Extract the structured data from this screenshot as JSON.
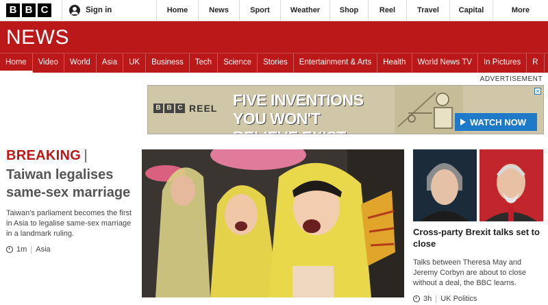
{
  "topbar": {
    "logo_letters": [
      "B",
      "B",
      "C"
    ],
    "signin_label": "Sign in",
    "nav": [
      "Home",
      "News",
      "Sport",
      "Weather",
      "Shop",
      "Reel",
      "Travel",
      "Capital",
      "More"
    ]
  },
  "news": {
    "title": "NEWS",
    "nav": [
      "Home",
      "Video",
      "World",
      "Asia",
      "UK",
      "Business",
      "Tech",
      "Science",
      "Stories",
      "Entertainment & Arts",
      "Health",
      "World News TV",
      "In Pictures",
      "R"
    ],
    "active_tab": "Home"
  },
  "ad": {
    "label": "ADVERTISEMENT",
    "brand_letters": [
      "B",
      "B",
      "C"
    ],
    "brand_suffix": "REEL",
    "headline": "FIVE INVENTIONS YOU WON'T BELIEVE EXIST",
    "cta": "WATCH NOW",
    "close_glyph": "✕"
  },
  "main_story": {
    "breaking_label": "BREAKING",
    "breaking_separator": "|",
    "headline": "Taiwan legalises same-sex marriage",
    "summary": "Taiwan's parliament becomes the first in Asia to legalise same-sex marriage in a landmark ruling.",
    "time": "1m",
    "section": "Asia"
  },
  "side_story": {
    "headline": "Cross-party Brexit talks set to close",
    "summary": "Talks between Theresa May and Jeremy Corbyn are about to close without a deal, the BBC learns.",
    "time": "3h",
    "section": "UK Politics"
  },
  "colors": {
    "brand_red": "#bb1919",
    "watch_blue": "#1e79c8"
  }
}
